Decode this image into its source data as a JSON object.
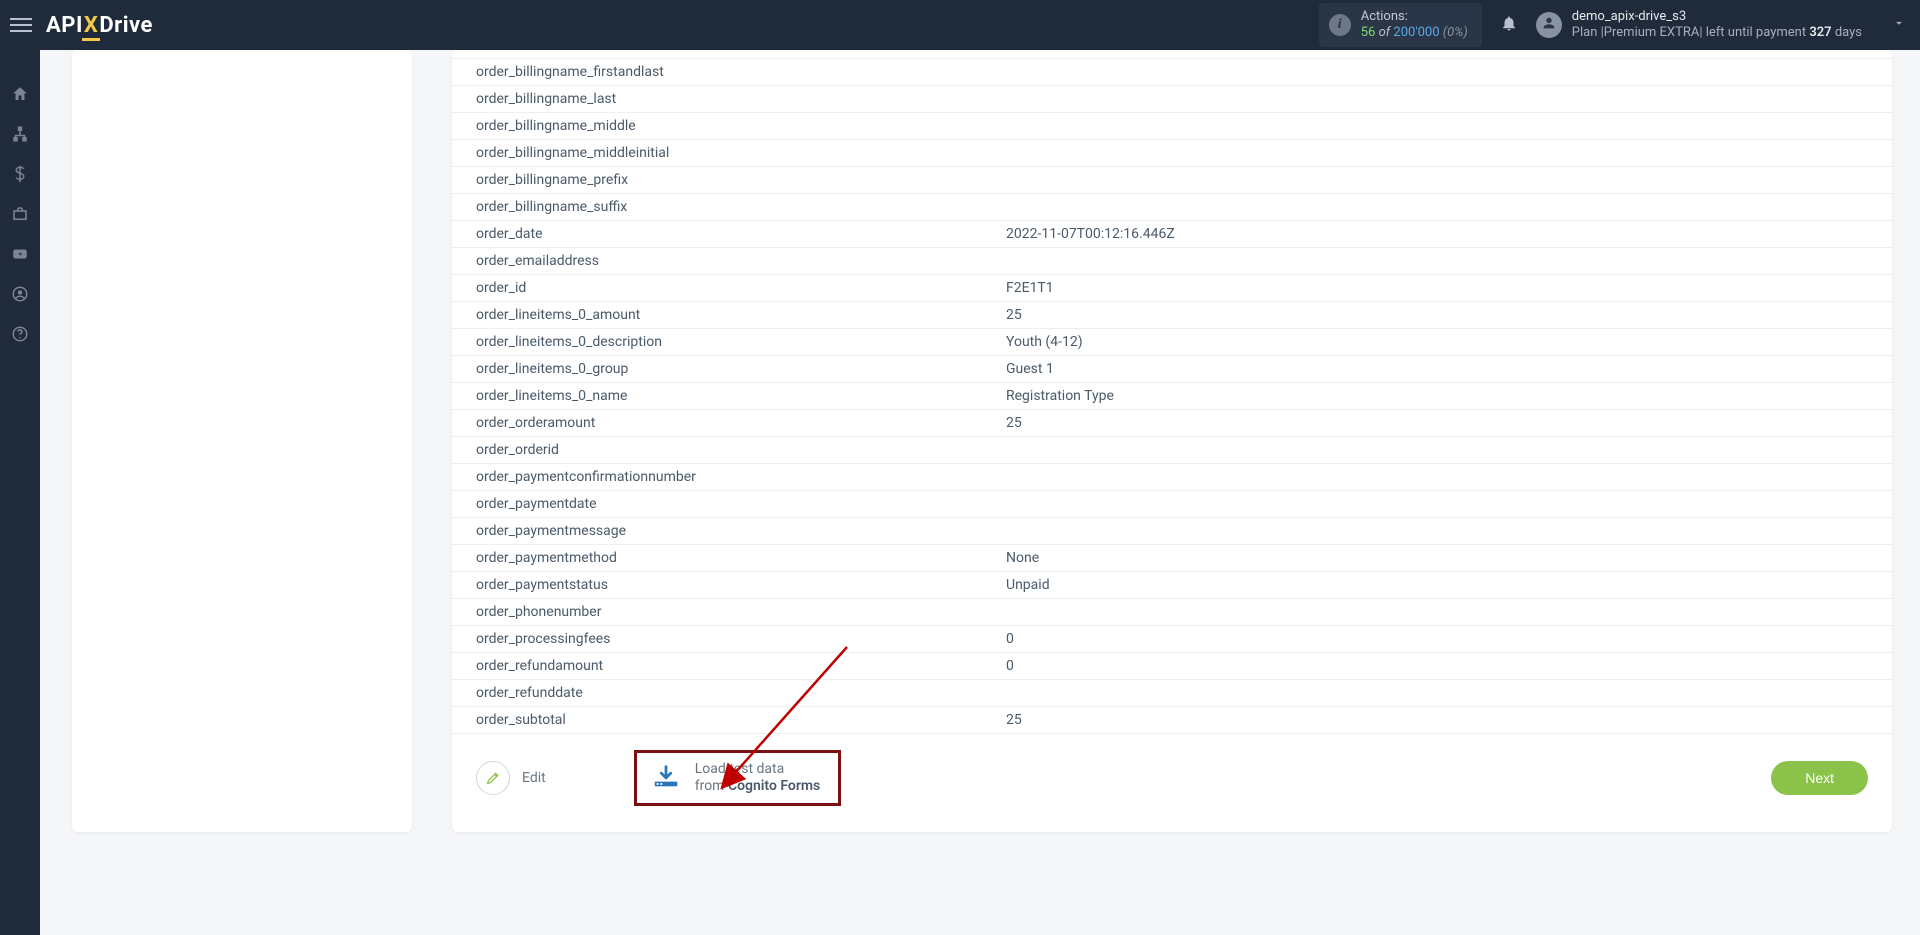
{
  "header": {
    "logo": {
      "part1": "API",
      "part2": "X",
      "part3": "Drive"
    },
    "actions": {
      "label": "Actions:",
      "count": "56",
      "of": "of",
      "total": "200'000",
      "pct": "(0%)"
    },
    "user": {
      "name": "demo_apix-drive_s3",
      "plan_prefix": "Plan |",
      "plan_name": "Premium EXTRA",
      "plan_mid": "| left until payment ",
      "days": "327",
      "days_suffix": " days"
    }
  },
  "rows": [
    {
      "k": "order_billingname_firstandlast",
      "v": ""
    },
    {
      "k": "order_billingname_last",
      "v": ""
    },
    {
      "k": "order_billingname_middle",
      "v": ""
    },
    {
      "k": "order_billingname_middleinitial",
      "v": ""
    },
    {
      "k": "order_billingname_prefix",
      "v": ""
    },
    {
      "k": "order_billingname_suffix",
      "v": ""
    },
    {
      "k": "order_date",
      "v": "2022-11-07T00:12:16.446Z"
    },
    {
      "k": "order_emailaddress",
      "v": ""
    },
    {
      "k": "order_id",
      "v": "F2E1T1"
    },
    {
      "k": "order_lineitems_0_amount",
      "v": "25"
    },
    {
      "k": "order_lineitems_0_description",
      "v": "Youth (4-12)"
    },
    {
      "k": "order_lineitems_0_group",
      "v": "Guest 1"
    },
    {
      "k": "order_lineitems_0_name",
      "v": "Registration Type"
    },
    {
      "k": "order_orderamount",
      "v": "25"
    },
    {
      "k": "order_orderid",
      "v": ""
    },
    {
      "k": "order_paymentconfirmationnumber",
      "v": ""
    },
    {
      "k": "order_paymentdate",
      "v": ""
    },
    {
      "k": "order_paymentmessage",
      "v": ""
    },
    {
      "k": "order_paymentmethod",
      "v": "None"
    },
    {
      "k": "order_paymentstatus",
      "v": "Unpaid"
    },
    {
      "k": "order_phonenumber",
      "v": ""
    },
    {
      "k": "order_processingfees",
      "v": "0"
    },
    {
      "k": "order_refundamount",
      "v": "0"
    },
    {
      "k": "order_refunddate",
      "v": ""
    },
    {
      "k": "order_subtotal",
      "v": "25"
    }
  ],
  "footer": {
    "edit": "Edit",
    "load_line1": "Load test data",
    "load_line2_prefix": "from ",
    "load_line2_bold": "Cognito Forms",
    "next": "Next"
  }
}
